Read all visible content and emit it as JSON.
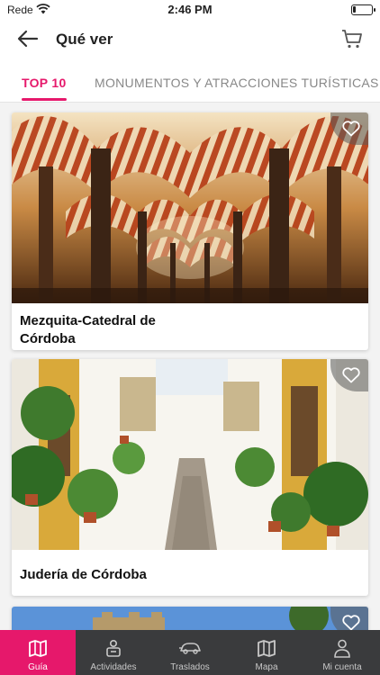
{
  "status_bar": {
    "carrier": "Rede",
    "time": "2:46 PM"
  },
  "header": {
    "title": "Qué ver"
  },
  "tabs": [
    {
      "label": "TOP 10"
    },
    {
      "label": "MONUMENTOS Y ATRACCIONES TURÍSTICAS"
    }
  ],
  "cards": [
    {
      "name": "Mezquita-Catedral de Córdoba",
      "favorite_icon": "heart-outline-icon"
    },
    {
      "name": "Judería de Córdoba",
      "favorite_icon": "heart-outline-icon"
    },
    {
      "name": "",
      "favorite_icon": "heart-outline-icon"
    }
  ],
  "bottom_nav": [
    {
      "label": "Guía",
      "icon": "guide-map-icon"
    },
    {
      "label": "Actividades",
      "icon": "activities-icon"
    },
    {
      "label": "Traslados",
      "icon": "car-icon"
    },
    {
      "label": "Mapa",
      "icon": "map-icon"
    },
    {
      "label": "Mi cuenta",
      "icon": "user-icon"
    }
  ],
  "colors": {
    "accent": "#e6186b",
    "nav_background": "#3a3b3d"
  }
}
